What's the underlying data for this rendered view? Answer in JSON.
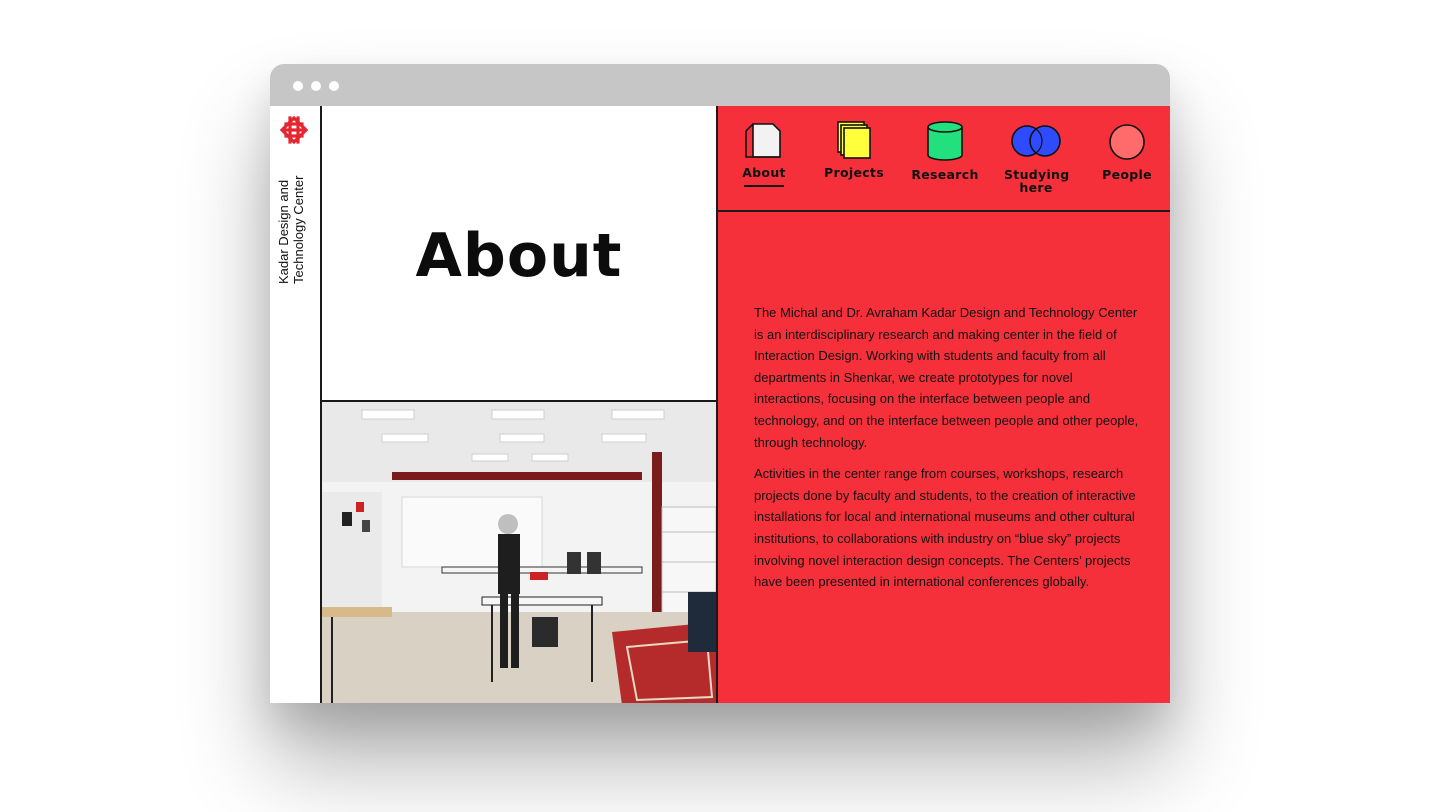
{
  "site": {
    "title_line1": "Kadar Design and",
    "title_line2": "Technology Center"
  },
  "hero": {
    "heading": "About"
  },
  "nav": {
    "items": [
      {
        "label": "About",
        "icon": "page-icon",
        "color": "#f2f2f2",
        "active": true
      },
      {
        "label": "Projects",
        "icon": "stacked-pages-icon",
        "color": "#ffff3b"
      },
      {
        "label": "Research",
        "icon": "cylinder-icon",
        "color": "#22e07d"
      },
      {
        "label": "Studying here",
        "icon": "double-circle-icon",
        "color": "#2f4bff"
      },
      {
        "label": "People",
        "icon": "circle-icon",
        "color": "#ff6a6a"
      }
    ]
  },
  "content": {
    "paragraph1": "The Michal and Dr. Avraham Kadar Design and Technology Center is an interdisciplinary  research and making center in the field of Interaction Design. Working with students and faculty from all departments in Shenkar, we create prototypes for novel interactions, focusing on the interface between people and technology, and on the interface between people and other people, through technology.",
    "paragraph2": "Activities in the center range from courses, workshops, research projects done by faculty and students, to the creation of interactive installations for local and international museums and other cultural institutions, to collaborations with industry on “blue sky” projects involving novel interaction design concepts. The Centers’ projects have been presented in international conferences globally."
  },
  "colors": {
    "accent": "#f6303b",
    "titlebar": "#c6c6c6",
    "logo": "#e32630"
  }
}
